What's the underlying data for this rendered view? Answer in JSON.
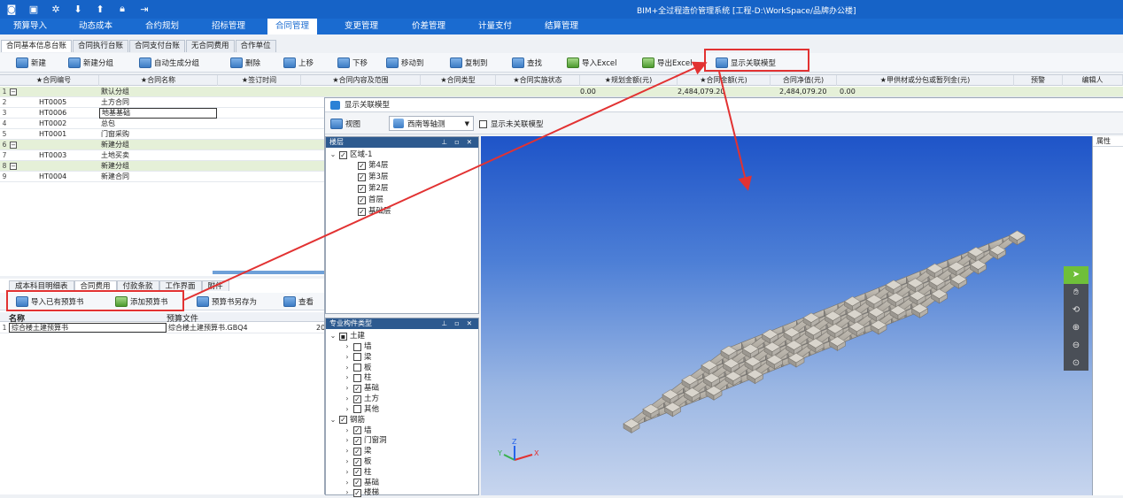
{
  "app": {
    "title": "BIM+全过程造价管理系统 [工程-D:\\WorkSpace/品牌办公楼]",
    "quick_icons": [
      "app-logo-icon",
      "save-icon",
      "settings-icon",
      "download-icon",
      "upload-icon",
      "lock-icon",
      "exit-icon"
    ]
  },
  "menu": [
    "预算导入",
    "动态成本",
    "合约规划",
    "招标管理",
    "合同管理",
    "变更管理",
    "价差管理",
    "计量支付",
    "结算管理"
  ],
  "subtabs": [
    "合同基本信息台账",
    "合同执行台账",
    "合同支付台账",
    "无合同费用",
    "合作单位"
  ],
  "toolbar": [
    "新建",
    "新建分组",
    "自动生成分组",
    "删除",
    "上移",
    "下移",
    "移动到",
    "复制到",
    "查找",
    "导入Excel",
    "导出Excel",
    "显示关联模型"
  ],
  "grid": {
    "headers": [
      "★合同编号",
      "★合同名称",
      "★签订时间",
      "★合同内容及范围",
      "★合同类型",
      "★合同实施状态",
      "★规划金额(元)",
      "★合同金额(元)",
      "合同净值(元)",
      "★甲供材或分包或暂列金(元)",
      "预警",
      "编辑人"
    ],
    "rows": [
      {
        "num": "1",
        "toggle": "−",
        "code": "",
        "name": "默认分组",
        "group": true,
        "plan": "0.00",
        "amount": "2,484,079.20",
        "net": "2,484,079.20",
        "supply": "0.00"
      },
      {
        "num": "2",
        "toggle": "",
        "code": "HT0005",
        "name": "土方合同",
        "group": false,
        "plan": "",
        "amount": "",
        "net": "",
        "supply": ""
      },
      {
        "num": "3",
        "toggle": "",
        "code": "HT0006",
        "name": "地基基础",
        "group": false,
        "plan": "",
        "amount": "",
        "net": "",
        "supply": ""
      },
      {
        "num": "4",
        "toggle": "",
        "code": "HT0002",
        "name": "总包",
        "group": false,
        "plan": "",
        "amount": "",
        "net": "",
        "supply": ""
      },
      {
        "num": "5",
        "toggle": "",
        "code": "HT0001",
        "name": "门窗采购",
        "group": false,
        "plan": "",
        "amount": "",
        "net": "",
        "supply": ""
      },
      {
        "num": "6",
        "toggle": "−",
        "code": "",
        "name": "新建分组",
        "group": true,
        "plan": "",
        "amount": "",
        "net": "",
        "supply": ""
      },
      {
        "num": "7",
        "toggle": "",
        "code": "HT0003",
        "name": "土地买卖",
        "group": false,
        "plan": "",
        "amount": "",
        "net": "",
        "supply": ""
      },
      {
        "num": "8",
        "toggle": "−",
        "code": "",
        "name": "新建分组",
        "group": true,
        "plan": "",
        "amount": "",
        "net": "",
        "supply": ""
      },
      {
        "num": "9",
        "toggle": "",
        "code": "HT0004",
        "name": "新建合同",
        "group": false,
        "plan": "",
        "amount": "",
        "net": "",
        "supply": ""
      }
    ]
  },
  "bottom": {
    "tabs": [
      "成本科目明细表",
      "合同费用",
      "付款条款",
      "工作界面",
      "附件"
    ],
    "toolbar": [
      "导入已有预算书",
      "添加预算书",
      "预算书另存为",
      "查看"
    ],
    "headers": [
      "名称",
      "预算文件"
    ],
    "rows": [
      {
        "num": "1",
        "name": "综合楼土建预算书",
        "file": "综合楼土建预算书.GBQ4",
        "extra": "20"
      }
    ]
  },
  "dialog": {
    "title": "显示关联模型",
    "view_label": "视图",
    "view_mode": "西南等轴测",
    "show_unlinked": "显示未关联模型",
    "floor_panel": {
      "title": "楼层",
      "root": "区域-1",
      "floors": [
        "第4层",
        "第3层",
        "第2层",
        "首层",
        "基础层"
      ]
    },
    "type_panel": {
      "title": "专业构件类型",
      "groups": [
        {
          "name": "土建",
          "items": [
            {
              "label": "墙",
              "checked": false
            },
            {
              "label": "梁",
              "checked": false
            },
            {
              "label": "板",
              "checked": false
            },
            {
              "label": "柱",
              "checked": false
            },
            {
              "label": "基础",
              "checked": true
            },
            {
              "label": "土方",
              "checked": true
            },
            {
              "label": "其他",
              "checked": false
            }
          ]
        },
        {
          "name": "钢筋",
          "items": [
            {
              "label": "墙",
              "checked": true
            },
            {
              "label": "门窗洞",
              "checked": true
            },
            {
              "label": "梁",
              "checked": true
            },
            {
              "label": "板",
              "checked": true
            },
            {
              "label": "柱",
              "checked": true
            },
            {
              "label": "基础",
              "checked": true
            },
            {
              "label": "楼梯",
              "checked": true
            }
          ]
        }
      ]
    },
    "props_title": "属性",
    "viewport_tools": [
      "select-icon",
      "pan-hand-icon",
      "orbit-icon",
      "zoom-in-icon",
      "zoom-out-icon",
      "zoom-extent-icon"
    ]
  },
  "colors": {
    "brand": "#1663c7",
    "annotation": "#e23232",
    "group_row": "#e5f0d8"
  }
}
